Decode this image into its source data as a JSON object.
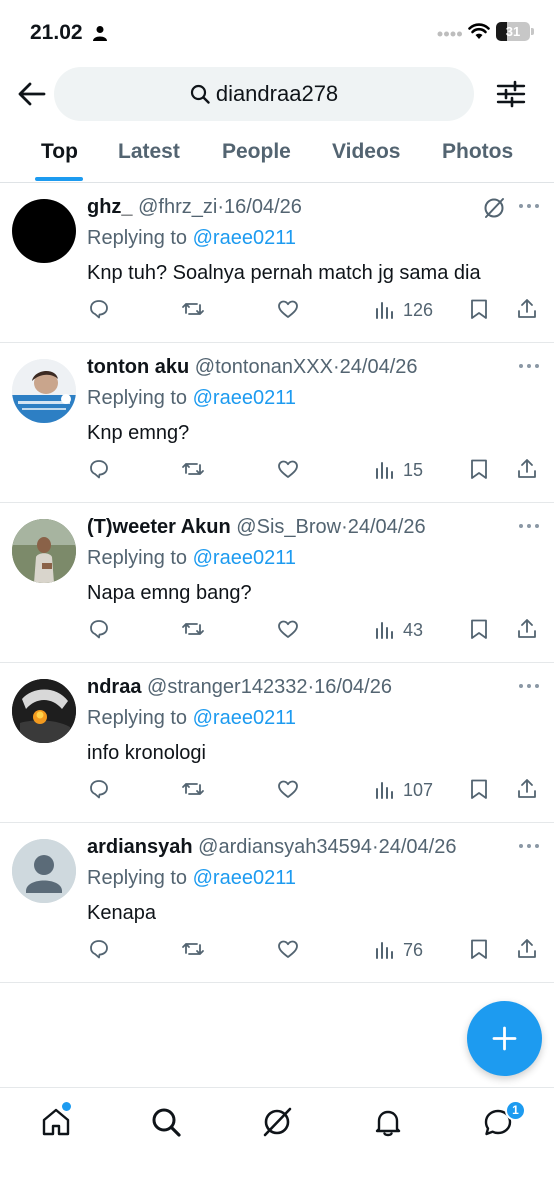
{
  "status_bar": {
    "time": "21.02",
    "battery": "31",
    "battery_level": 0.31
  },
  "search": {
    "query": "diandraa278"
  },
  "tabs": [
    {
      "label": "Top",
      "active": true
    },
    {
      "label": "Latest",
      "active": false
    },
    {
      "label": "People",
      "active": false
    },
    {
      "label": "Videos",
      "active": false
    },
    {
      "label": "Photos",
      "active": false
    }
  ],
  "tweets": [
    {
      "name": "ghz_",
      "handle": "@fhrz_zi",
      "date": "16/04/26",
      "replying_label": "Replying to",
      "mention": "@raee0211",
      "text": "Knp tuh? Soalnya pernah match jg sama dia",
      "views": "126",
      "avatar": "black-circle"
    },
    {
      "name": "tonton aku",
      "handle": "@tontonanXXX",
      "date": "24/04/26",
      "replying_label": "Replying to",
      "mention": "@raee0211",
      "text": "Knp emng?",
      "views": "15",
      "avatar": "photo"
    },
    {
      "name": "(T)weeter Akun",
      "handle": "@Sis_Brow",
      "date": "24/04/26",
      "replying_label": "Replying to",
      "mention": "@raee0211",
      "text": "Napa emng bang?",
      "views": "43",
      "avatar": "photo"
    },
    {
      "name": "ndraa",
      "handle": "@stranger142332",
      "date": "16/04/26",
      "replying_label": "Replying to",
      "mention": "@raee0211",
      "text": "info kronologi",
      "views": "107",
      "avatar": "photo"
    },
    {
      "name": "ardiansyah",
      "handle": "@ardiansyah34594",
      "date": "24/04/26",
      "replying_label": "Replying to",
      "mention": "@raee0211",
      "text": "Kenapa",
      "views": "76",
      "avatar": "default"
    }
  ],
  "bottom_nav": {
    "messages_badge": "1"
  },
  "colors": {
    "accent": "#1d9bf0",
    "text": "#0f1419",
    "muted": "#536471"
  }
}
